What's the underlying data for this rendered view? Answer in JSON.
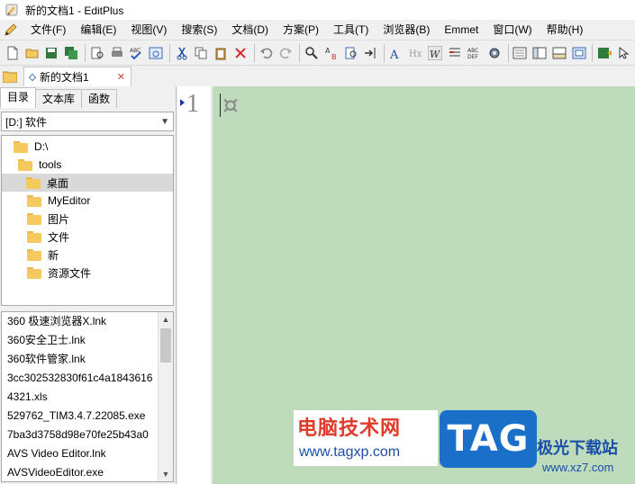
{
  "window": {
    "title": "新的文档1 - EditPlus"
  },
  "menu": {
    "items": [
      {
        "label": "文件(F)"
      },
      {
        "label": "编辑(E)"
      },
      {
        "label": "视图(V)"
      },
      {
        "label": "搜索(S)"
      },
      {
        "label": "文档(D)"
      },
      {
        "label": "方案(P)"
      },
      {
        "label": "工具(T)"
      },
      {
        "label": "浏览器(B)"
      },
      {
        "label": "Emmet"
      },
      {
        "label": "窗口(W)"
      },
      {
        "label": "帮助(H)"
      }
    ]
  },
  "toolbar": {
    "buttons": [
      {
        "icon": "new-file-icon",
        "glyph": "📄"
      },
      {
        "icon": "open-folder-icon",
        "glyph": "📂"
      },
      {
        "icon": "save-icon",
        "glyph": "💾"
      },
      {
        "icon": "save-all-icon",
        "glyph": "🗂"
      },
      {
        "icon": "print-preview-icon",
        "glyph": "🔍"
      },
      {
        "icon": "print-icon",
        "glyph": "🖶"
      },
      {
        "icon": "spellcheck-icon",
        "glyph": "✔"
      },
      {
        "icon": "browser-preview-icon",
        "glyph": "🌐"
      },
      {
        "icon": "cut-icon",
        "glyph": "✂"
      },
      {
        "icon": "copy-icon",
        "glyph": "⧉"
      },
      {
        "icon": "paste-icon",
        "glyph": "📋"
      },
      {
        "icon": "delete-icon",
        "glyph": "✕"
      },
      {
        "icon": "undo-icon",
        "glyph": "↶"
      },
      {
        "icon": "redo-icon",
        "glyph": "↷"
      },
      {
        "icon": "find-icon",
        "glyph": "🔎"
      },
      {
        "icon": "replace-icon",
        "glyph": "⇄"
      },
      {
        "icon": "find-in-files-icon",
        "glyph": "🔍"
      },
      {
        "icon": "goto-line-icon",
        "glyph": "⇥"
      },
      {
        "icon": "font-icon",
        "glyph": "A"
      },
      {
        "icon": "html-tag-icon",
        "glyph": "H"
      },
      {
        "icon": "word-wrap-icon",
        "glyph": "W"
      },
      {
        "icon": "line-numbers-icon",
        "glyph": "≡"
      },
      {
        "icon": "column-ruler-icon",
        "glyph": "▦"
      },
      {
        "icon": "settings-icon",
        "glyph": "⚙"
      },
      {
        "icon": "cliptext-icon",
        "glyph": "▤"
      },
      {
        "icon": "directory-window-icon",
        "glyph": "▥"
      },
      {
        "icon": "output-window-icon",
        "glyph": "▧"
      },
      {
        "icon": "fullscreen-icon",
        "glyph": "▣"
      },
      {
        "icon": "run-icon",
        "glyph": "▶"
      },
      {
        "icon": "pointer-icon",
        "glyph": "↖"
      }
    ]
  },
  "tabs": {
    "documents": [
      {
        "label": "新的文档1"
      }
    ]
  },
  "sidebar": {
    "tabs": [
      {
        "label": "目录",
        "active": true
      },
      {
        "label": "文本库"
      },
      {
        "label": "函数"
      }
    ],
    "drive": "[D:] 软件",
    "tree": [
      {
        "label": "D:\\",
        "level": 1
      },
      {
        "label": "tools",
        "level": 2
      },
      {
        "label": "桌面",
        "level": 3,
        "selected": true
      },
      {
        "label": "MyEditor",
        "level": 4
      },
      {
        "label": "图片",
        "level": 4
      },
      {
        "label": "文件",
        "level": 4
      },
      {
        "label": "新",
        "level": 4
      },
      {
        "label": "资源文件",
        "level": 4
      }
    ],
    "files": [
      {
        "label": "360 极速浏览器X.lnk"
      },
      {
        "label": "360安全卫士.lnk"
      },
      {
        "label": "360软件管家.lnk"
      },
      {
        "label": "3cc302532830f61c4a1843616"
      },
      {
        "label": "4321.xls"
      },
      {
        "label": "529762_TIM3.4.7.22085.exe"
      },
      {
        "label": "7ba3d3758d98e70fe25b43a0"
      },
      {
        "label": "AVS Video Editor.lnk"
      },
      {
        "label": "AVSVideoEditor.exe"
      }
    ]
  },
  "editor": {
    "line_number": "1",
    "background": "#bedcbc",
    "cursor_glyph": "¤"
  },
  "watermark": {
    "site_cn": "电脑技术网",
    "site_url": "www.tagxp.com",
    "badge": "TAG",
    "site2_cn": "极光下载站",
    "site2_url": "www.xz7.com"
  }
}
